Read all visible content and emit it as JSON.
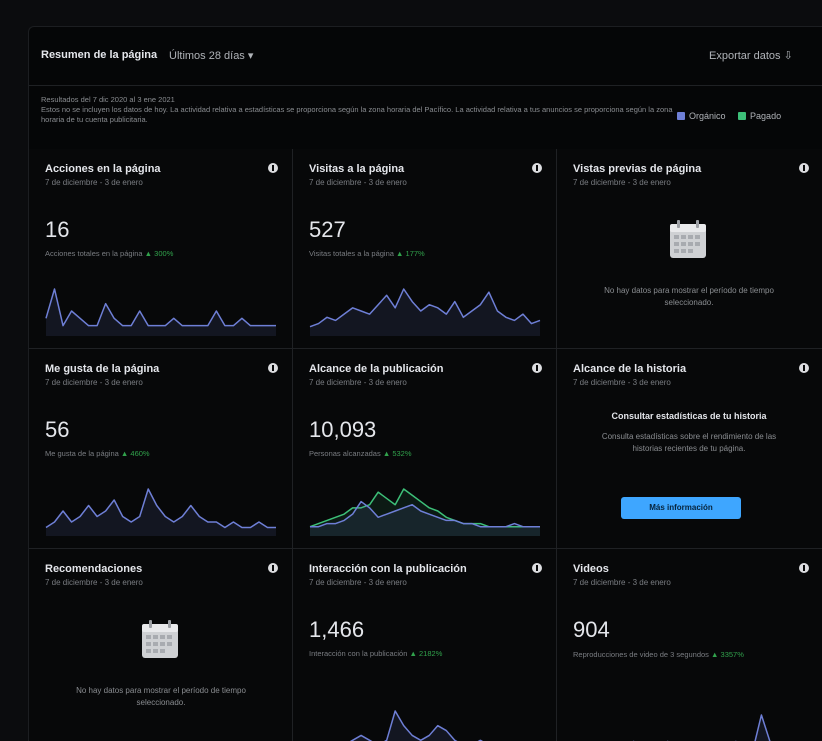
{
  "header": {
    "title": "Resumen de la página",
    "range": "Últimos 28 días ▾",
    "export": "Exportar datos ⇩"
  },
  "info": {
    "line1": "Resultados del 7 dic 2020 al 3 ene 2021",
    "line2": "Estos no se incluyen los datos de hoy. La actividad relativa a estadísticas se proporciona según la zona horaria del Pacífico. La actividad relativa a tus anuncios se proporciona según la zona horaria de tu cuenta publicitaria."
  },
  "legend": {
    "organic": "Orgánico",
    "paid": "Pagado"
  },
  "colors": {
    "organic": "#6e7fd6",
    "paid": "#3dbf78",
    "delta": "#31a24c",
    "button": "#3ea6ff"
  },
  "cards": [
    {
      "title": "Acciones en la página",
      "subtitle": "7 de diciembre - 3 de enero",
      "value": "16",
      "desc": "Acciones totales en la página",
      "delta": "▲ 300%",
      "spark_organic": [
        2,
        6,
        1,
        3,
        2,
        1,
        1,
        4,
        2,
        1,
        1,
        3,
        1,
        1,
        1,
        2,
        1,
        1,
        1,
        1,
        3,
        1,
        1,
        2,
        1,
        1,
        1,
        1
      ]
    },
    {
      "title": "Visitas a la página",
      "subtitle": "7 de diciembre - 3 de enero",
      "value": "527",
      "desc": "Visitas totales a la página",
      "delta": "▲ 177%",
      "spark_organic": [
        2,
        3,
        5,
        4,
        6,
        8,
        7,
        6,
        9,
        12,
        8,
        14,
        10,
        7,
        9,
        8,
        6,
        10,
        5,
        7,
        9,
        13,
        7,
        5,
        4,
        6,
        3,
        4
      ]
    },
    {
      "title": "Vistas previas de página",
      "subtitle": "7 de diciembre - 3 de enero",
      "empty_text": "No hay datos para mostrar el período de tiempo seleccionado."
    },
    {
      "title": "Me gusta de la página",
      "subtitle": "7 de diciembre - 3 de enero",
      "value": "56",
      "desc": "Me gusta de la página",
      "delta": "▲ 460%",
      "spark_organic": [
        1,
        2,
        4,
        2,
        3,
        5,
        3,
        4,
        6,
        3,
        2,
        3,
        8,
        5,
        3,
        2,
        3,
        5,
        3,
        2,
        2,
        1,
        2,
        1,
        1,
        2,
        1,
        1
      ]
    },
    {
      "title": "Alcance de la publicación",
      "subtitle": "7 de diciembre - 3 de enero",
      "value": "10,093",
      "desc": "Personas alcanzadas",
      "delta": "▲ 532%",
      "spark_organic": [
        2,
        2,
        3,
        3,
        4,
        6,
        10,
        8,
        5,
        6,
        7,
        8,
        9,
        7,
        6,
        5,
        4,
        4,
        3,
        3,
        2,
        2,
        2,
        2,
        3,
        2,
        2,
        2
      ],
      "spark_paid": [
        2,
        3,
        4,
        5,
        6,
        8,
        8,
        9,
        13,
        11,
        9,
        14,
        12,
        10,
        8,
        7,
        5,
        4,
        3,
        3,
        3,
        2,
        2,
        2,
        2,
        2,
        2,
        2
      ]
    },
    {
      "title": "Alcance de la historia",
      "subtitle": "7 de diciembre - 3 de enero",
      "story_head": "Consultar estadísticas de tu historia",
      "story_body": "Consulta estadísticas sobre el rendimiento de las historias recientes de tu página.",
      "button": "Más información"
    },
    {
      "title": "Recomendaciones",
      "subtitle": "7 de diciembre - 3 de enero",
      "empty_text": "No hay datos para mostrar el período de tiempo seleccionado."
    },
    {
      "title": "Interacción con la publicación",
      "subtitle": "7 de diciembre - 3 de enero",
      "value": "1,466",
      "desc": "Interacción con la publicación",
      "delta": "▲ 2182%",
      "spark_organic": [
        1,
        1,
        1,
        2,
        2,
        3,
        4,
        3,
        2,
        3,
        9,
        6,
        4,
        3,
        4,
        6,
        5,
        3,
        2,
        2,
        3,
        2,
        2,
        1,
        2,
        1,
        1,
        1
      ]
    },
    {
      "title": "Videos",
      "subtitle": "7 de diciembre - 3 de enero",
      "value": "904",
      "desc": "Reproducciones de video de 3 segundos",
      "delta": "▲ 3357%",
      "spark_organic": [
        1,
        1,
        1,
        1,
        1,
        1,
        1,
        2,
        1,
        1,
        1,
        2,
        1,
        1,
        1,
        1,
        1,
        1,
        1,
        2,
        1,
        1,
        5,
        2,
        1,
        1,
        1,
        1
      ]
    }
  ]
}
